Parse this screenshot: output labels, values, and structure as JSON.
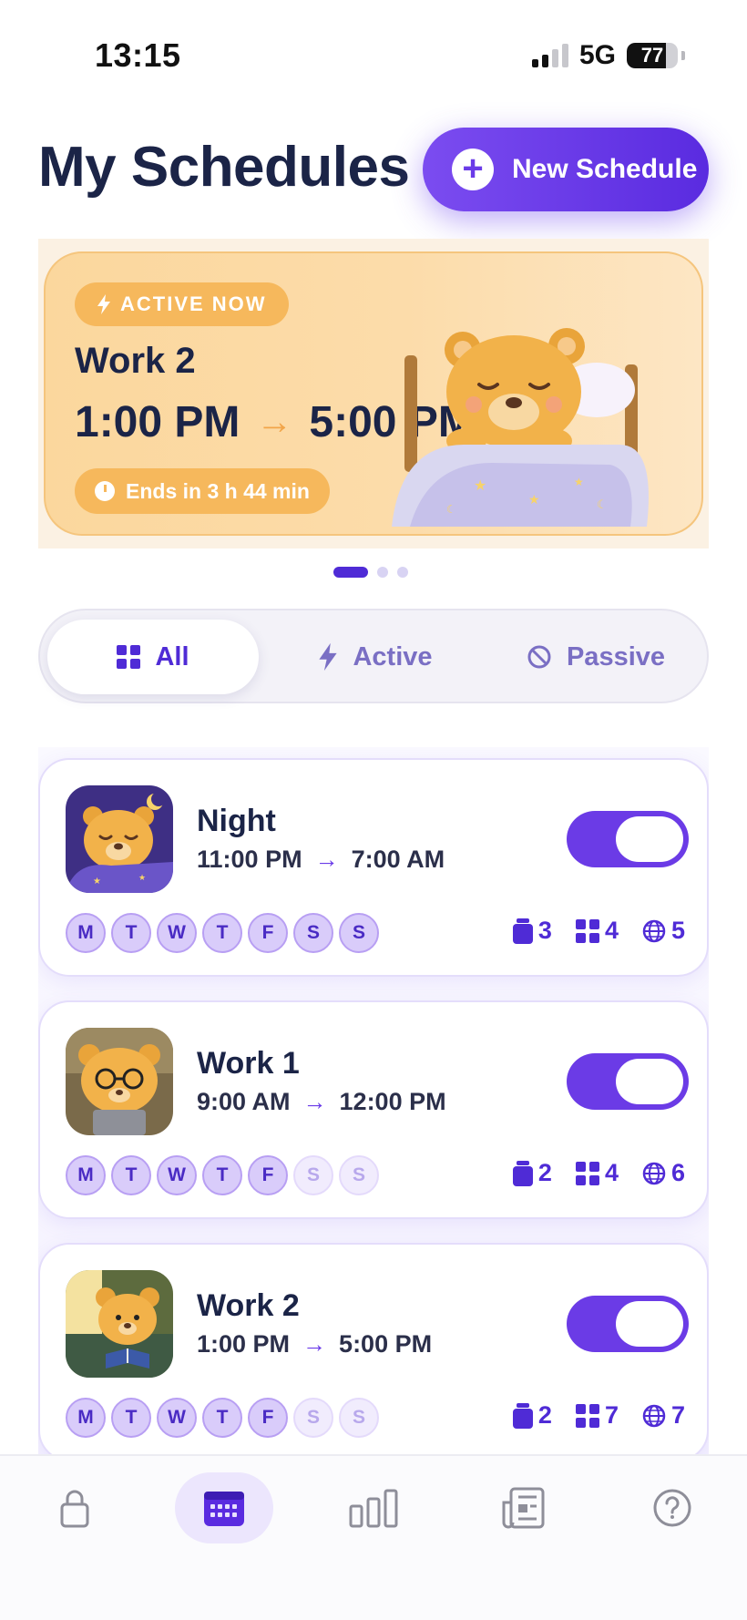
{
  "status": {
    "time": "13:15",
    "network": "5G",
    "battery": "77",
    "battery_level": 0.77
  },
  "header": {
    "title": "My Schedules",
    "new_button_label": "New Schedule"
  },
  "active_card": {
    "badge": "ACTIVE NOW",
    "name": "Work 2",
    "start": "1:00 PM",
    "arrow": "→",
    "end": "5:00 PM",
    "ends_in": "Ends in 3 h 44 min"
  },
  "pager": {
    "count": 3,
    "current": 1
  },
  "filter": {
    "all": "All",
    "active": "Active",
    "passive": "Passive",
    "selected": "All"
  },
  "schedules": [
    {
      "name": "Night",
      "start": "11:00 PM",
      "arrow": "→",
      "end": "7:00 AM",
      "enabled": true,
      "days": [
        "M",
        "T",
        "W",
        "T",
        "F",
        "S",
        "S"
      ],
      "days_on": [
        true,
        true,
        true,
        true,
        true,
        true,
        true
      ],
      "apps": "3",
      "categories": "4",
      "websites": "5"
    },
    {
      "name": "Work 1",
      "start": "9:00 AM",
      "arrow": "→",
      "end": "12:00 PM",
      "enabled": true,
      "days": [
        "M",
        "T",
        "W",
        "T",
        "F",
        "S",
        "S"
      ],
      "days_on": [
        true,
        true,
        true,
        true,
        true,
        false,
        false
      ],
      "apps": "2",
      "categories": "4",
      "websites": "6"
    },
    {
      "name": "Work 2",
      "start": "1:00 PM",
      "arrow": "→",
      "end": "5:00 PM",
      "enabled": true,
      "days": [
        "M",
        "T",
        "W",
        "T",
        "F",
        "S",
        "S"
      ],
      "days_on": [
        true,
        true,
        true,
        true,
        true,
        false,
        false
      ],
      "apps": "2",
      "categories": "7",
      "websites": "7"
    }
  ],
  "tabbar": {
    "items": [
      "lock-icon",
      "calendar-icon",
      "bar-chart-icon",
      "newspaper-icon",
      "help-icon"
    ],
    "selected": "calendar-icon"
  },
  "colors": {
    "accent": "#6b3be6",
    "active_card": "#fbd79d",
    "active_pill": "#f6b85c",
    "title": "#1b2447"
  }
}
